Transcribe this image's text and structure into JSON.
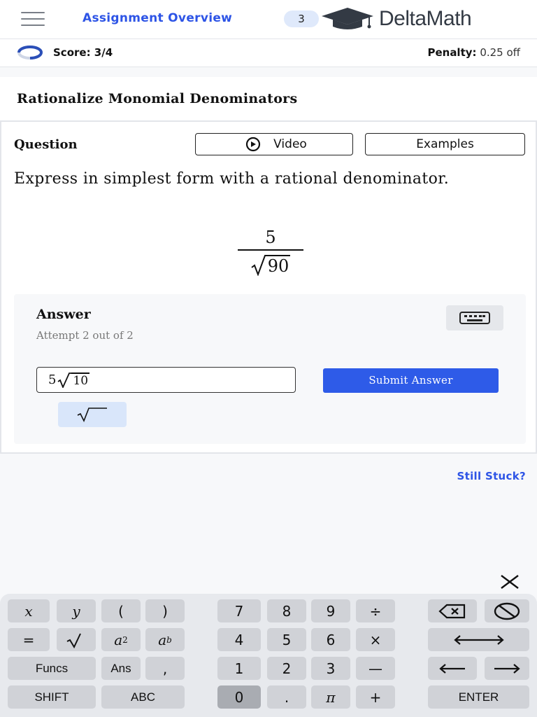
{
  "header": {
    "assignment_link": "Assignment Overview",
    "count_badge": "3",
    "logo_text": "DeltaMath",
    "logo_icon": "graduation-cap-icon",
    "menu_icon": "hamburger-menu-icon"
  },
  "score": {
    "label": "Score: 3/4",
    "penalty_label": "Penalty:",
    "penalty_value": "0.25 off"
  },
  "page": {
    "title": "Rationalize Monomial Denominators"
  },
  "question": {
    "label": "Question",
    "video_button": "Video",
    "examples_button": "Examples",
    "prompt": "Express in simplest form with a rational denominator.",
    "numerator": "5",
    "radicand": "90"
  },
  "answer": {
    "label": "Answer",
    "attempt": "Attempt 2 out of 2",
    "input_coefficient": "5",
    "input_radicand": "10",
    "submit_button": "Submit Answer"
  },
  "links": {
    "still_stuck": "Still Stuck?"
  },
  "keypad": {
    "row1": [
      "x",
      "y",
      "(",
      ")",
      "7",
      "8",
      "9",
      "÷"
    ],
    "row2": [
      "=",
      "a",
      "a",
      "4",
      "5",
      "6",
      "×"
    ],
    "row3": [
      "Funcs",
      "Ans",
      ",",
      "1",
      "2",
      "3",
      "—"
    ],
    "row4": [
      "SHIFT",
      "ABC",
      "0",
      ".",
      "π",
      "+",
      "ENTER"
    ],
    "a2_sup": "2",
    "ab_sup": "b"
  },
  "colors": {
    "accent": "#2e5be8",
    "link": "#2d54e6",
    "badge_bg": "#dfe9fb",
    "tool_bg": "#d9e6fa"
  }
}
